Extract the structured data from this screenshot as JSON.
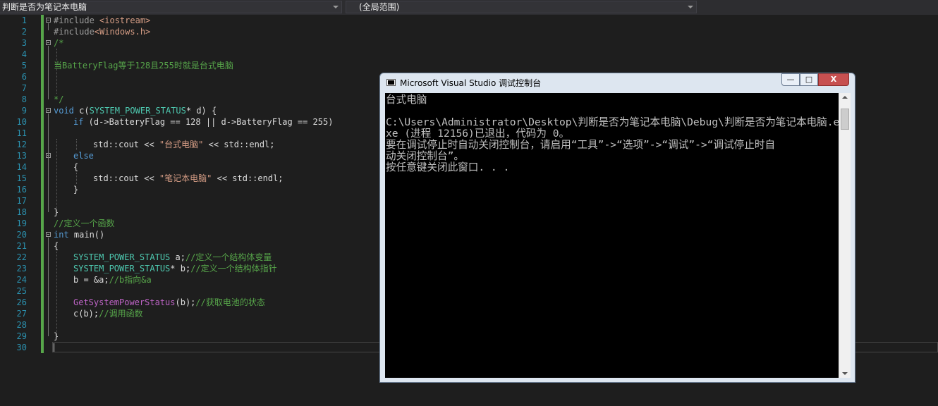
{
  "nav": {
    "scope_dropdown": "判断是否为笔记本电脑",
    "member_dropdown": "(全局范围)"
  },
  "editor": {
    "line_numbers": [
      "1",
      "2",
      "3",
      "4",
      "5",
      "6",
      "7",
      "8",
      "9",
      "10",
      "11",
      "12",
      "13",
      "14",
      "15",
      "16",
      "17",
      "18",
      "19",
      "20",
      "21",
      "22",
      "23",
      "24",
      "25",
      "26",
      "27",
      "28",
      "29",
      "30"
    ],
    "lines": {
      "l1_pp": "#include ",
      "l1_inc": "<iostream>",
      "l2_pp": "#include",
      "l2_inc": "<Windows.h>",
      "l3": "/*",
      "l5": "当BatteryFlag等于128且255时就是台式电脑",
      "l8": "*/",
      "l9_kw": "void",
      "l9_fn": " c(",
      "l9_ty": "SYSTEM_POWER_STATUS",
      "l9_rest": "* d) {",
      "l10_kw": "if",
      "l10_rest": " (d->BatteryFlag == 128 || d->BatteryFlag == 255)",
      "l12_a": "std::cout << ",
      "l12_str": "\"台式电脑\"",
      "l12_b": " << std::endl;",
      "l13_kw": "else",
      "l14": "{",
      "l15_a": "std::cout << ",
      "l15_str": "\"笔记本电脑\"",
      "l15_b": " << std::endl;",
      "l16": "}",
      "l18": "}",
      "l19": "//定义一个函数",
      "l20_kw": "int",
      "l20_rest": " main()",
      "l21": "{",
      "l22_ty": "SYSTEM_POWER_STATUS",
      "l22_rest": " a;",
      "l22_cm": "//定义一个结构体变量",
      "l23_ty": "SYSTEM_POWER_STATUS",
      "l23_rest": "* b;",
      "l23_cm": "//定义一个结构体指针",
      "l24_rest": "b = &a;",
      "l24_cm": "//b指向&a",
      "l26_mac": "GetSystemPowerStatus",
      "l26_rest": "(b);",
      "l26_cm": "//获取电池的状态",
      "l27_rest": "c(b);",
      "l27_cm": "//调用函数",
      "l29": "}"
    }
  },
  "console": {
    "title": "Microsoft Visual Studio 调试控制台",
    "minimize": "—",
    "maximize": "□",
    "close": "X",
    "output": "台式电脑\n\nC:\\Users\\Administrator\\Desktop\\判断是否为笔记本电脑\\Debug\\判断是否为笔记本电脑.e\nxe (进程 12156)已退出，代码为 0。\n要在调试停止时自动关闭控制台，请启用“工具”->“选项”->“调试”->“调试停止时自\n动关闭控制台”。\n按任意键关闭此窗口. . ."
  },
  "colors": {
    "editor_bg": "#1e1e1e",
    "keyword": "#569cd6",
    "comment": "#57a64a",
    "string": "#d69d85",
    "type": "#4ec9b0",
    "line_number": "#2b91af"
  }
}
